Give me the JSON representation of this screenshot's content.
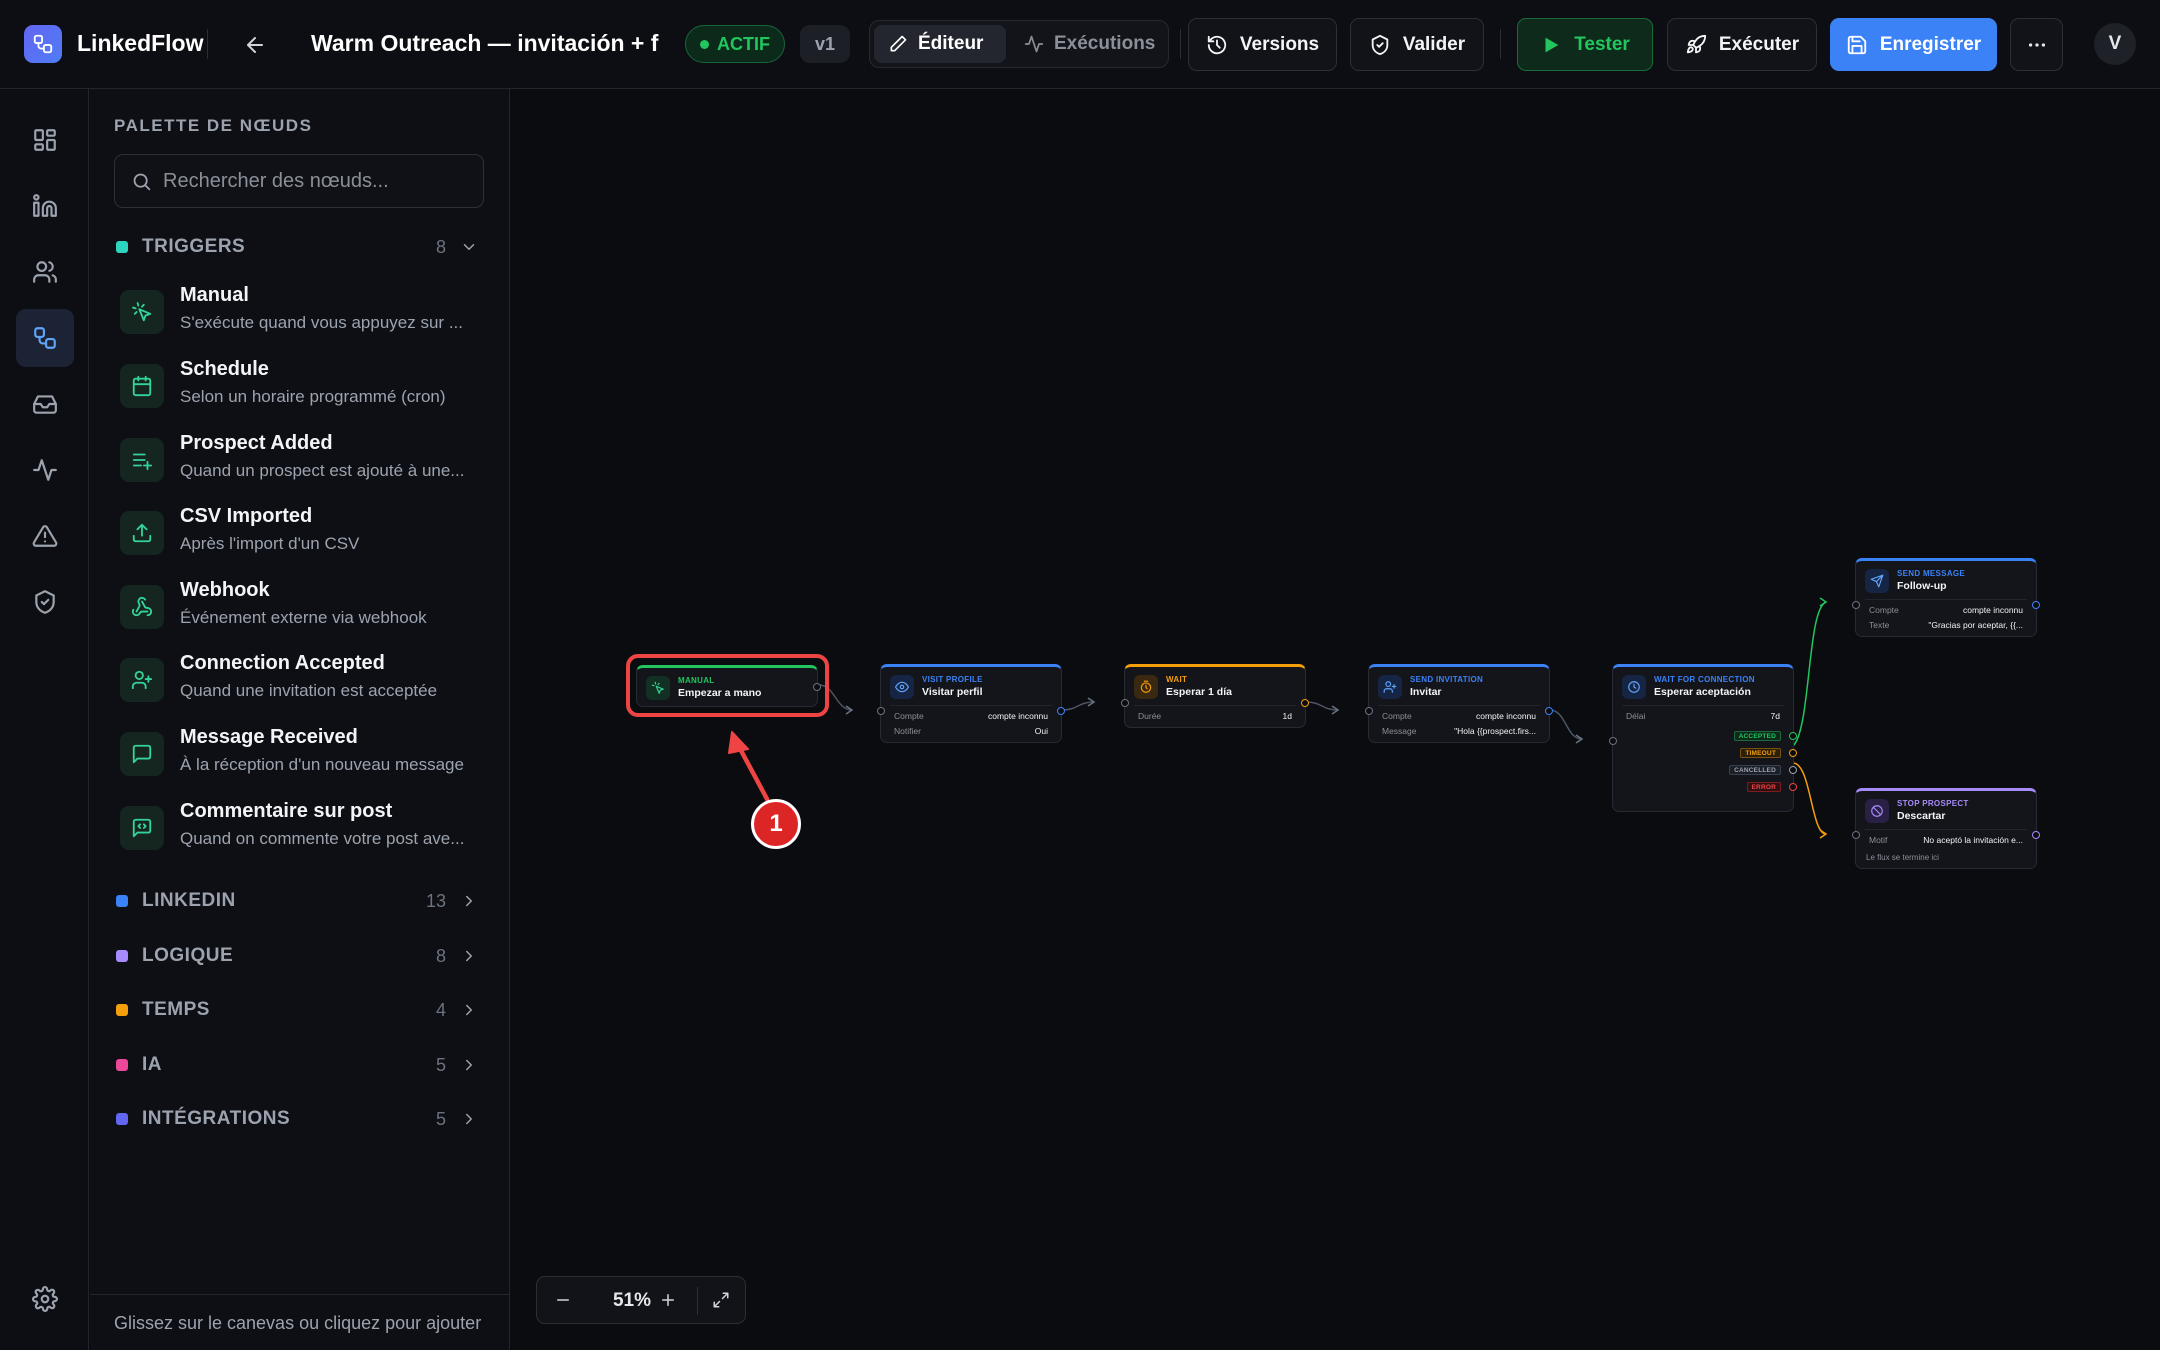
{
  "app": {
    "name": "LinkedFlow",
    "workflow_title": "Warm Outreach — invitación + foll",
    "status": "ACTIF",
    "version": "v1"
  },
  "toolbar": {
    "editor_tab": "Éditeur",
    "executions_tab": "Exécutions",
    "versions": "Versions",
    "validate": "Valider",
    "test": "Tester",
    "execute": "Exécuter",
    "save": "Enregistrer",
    "avatar": "V"
  },
  "sidebar_icons": [
    "dashboard-icon",
    "linkedin-icon",
    "users-icon",
    "workflows-icon",
    "inbox-icon",
    "activity-icon",
    "alert-icon",
    "shield-icon",
    "settings-icon"
  ],
  "palette": {
    "title": "PALETTE DE NŒUDS",
    "search_placeholder": "Rechercher des nœuds...",
    "footer": "Glissez sur le canevas ou cliquez pour ajouter",
    "categories": [
      {
        "name": "TRIGGERS",
        "count": "8",
        "color": "#2dd4bf",
        "expanded": true
      },
      {
        "name": "LINKEDIN",
        "count": "13",
        "color": "#3b82f6"
      },
      {
        "name": "LOGIQUE",
        "count": "8",
        "color": "#a78bfa"
      },
      {
        "name": "TEMPS",
        "count": "4",
        "color": "#f59e0b"
      },
      {
        "name": "IA",
        "count": "5",
        "color": "#ec4899"
      },
      {
        "name": "INTÉGRATIONS",
        "count": "5",
        "color": "#6366f1"
      }
    ],
    "triggers": [
      {
        "title": "Manual",
        "desc": "S'exécute quand vous appuyez sur ...",
        "icon": "pointer-click-icon"
      },
      {
        "title": "Schedule",
        "desc": "Selon un horaire programmé (cron)",
        "icon": "calendar-icon"
      },
      {
        "title": "Prospect Added",
        "desc": "Quand un prospect est ajouté à une...",
        "icon": "list-plus-icon"
      },
      {
        "title": "CSV Imported",
        "desc": "Après l'import d'un CSV",
        "icon": "upload-icon"
      },
      {
        "title": "Webhook",
        "desc": "Événement externe via webhook",
        "icon": "webhook-icon"
      },
      {
        "title": "Connection Accepted",
        "desc": "Quand une invitation est acceptée",
        "icon": "user-plus-icon"
      },
      {
        "title": "Message Received",
        "desc": "À la réception d'un nouveau message",
        "icon": "message-icon"
      },
      {
        "title": "Commentaire sur post",
        "desc": "Quand on commente votre post ave...",
        "icon": "comment-code-icon"
      }
    ]
  },
  "canvas": {
    "zoom": "51%",
    "annotation": "1",
    "nodes": {
      "manual": {
        "kind": "MANUAL",
        "name": "Empezar a mano",
        "color": "#22c55e"
      },
      "visit": {
        "kind": "VISIT PROFILE",
        "name": "Visitar perfil",
        "color": "#3b82f6",
        "rows": [
          {
            "k": "Compte",
            "v": "compte inconnu"
          },
          {
            "k": "Notifier",
            "v": "Oui"
          }
        ]
      },
      "wait": {
        "kind": "WAIT",
        "name": "Esperar 1 día",
        "color": "#f59e0b",
        "rows": [
          {
            "k": "Durée",
            "v": "1d"
          }
        ]
      },
      "invite": {
        "kind": "SEND INVITATION",
        "name": "Invitar",
        "color": "#3b82f6",
        "rows": [
          {
            "k": "Compte",
            "v": "compte inconnu"
          },
          {
            "k": "Message",
            "v": "\"Hola {{prospect.firs..."
          }
        ]
      },
      "waitconn": {
        "kind": "WAIT FOR CONNECTION",
        "name": "Esperar aceptación",
        "color": "#3b82f6",
        "rows": [
          {
            "k": "Délai",
            "v": "7d"
          }
        ],
        "ports": [
          "ACCEPTED",
          "TIMEOUT",
          "CANCELLED",
          "ERROR"
        ]
      },
      "sendmsg": {
        "kind": "SEND MESSAGE",
        "name": "Follow-up",
        "color": "#3b82f6",
        "rows": [
          {
            "k": "Compte",
            "v": "compte inconnu"
          },
          {
            "k": "Texte",
            "v": "\"Gracias por aceptar, {{..."
          }
        ]
      },
      "stop": {
        "kind": "STOP PROSPECT",
        "name": "Descartar",
        "color": "#a78bfa",
        "rows": [
          {
            "k": "Motif",
            "v": "No aceptó la invitación e..."
          }
        ],
        "note": "Le flux se termine ici"
      }
    }
  }
}
